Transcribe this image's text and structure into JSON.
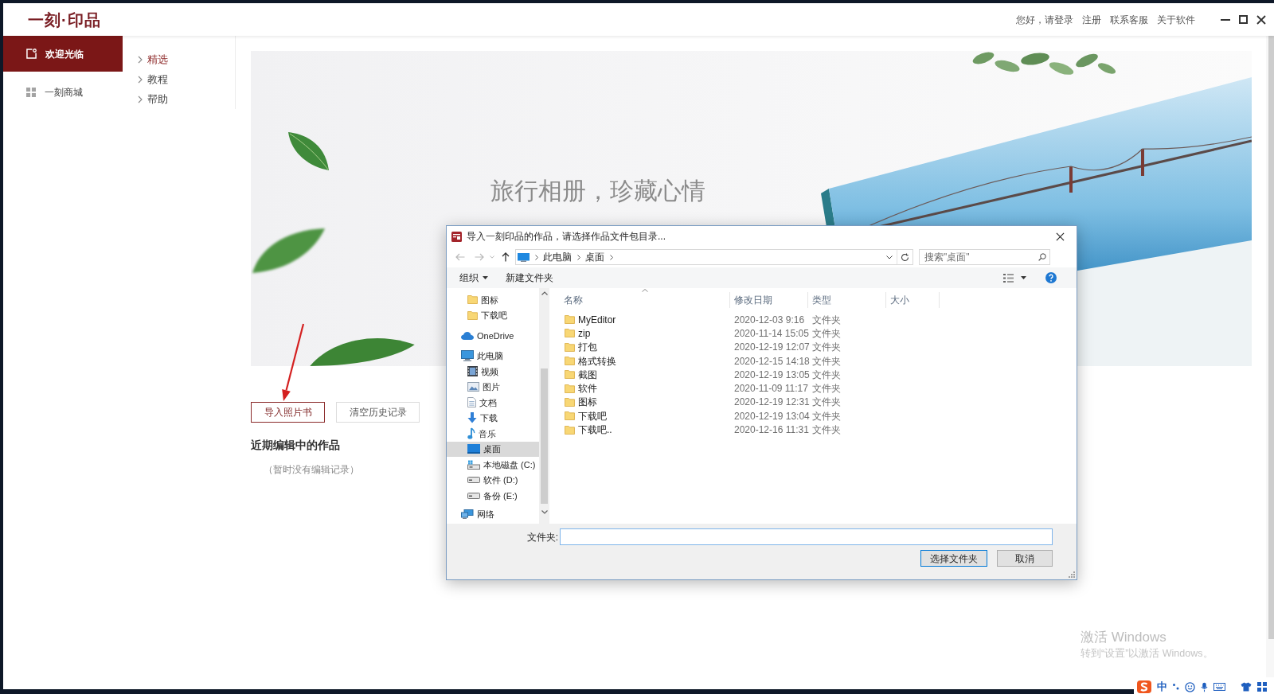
{
  "app": {
    "logo": "一刻·印品",
    "header_links": [
      "您好，请登录",
      "注册",
      "联系客服",
      "关于软件"
    ]
  },
  "sidebar": {
    "items": [
      {
        "label": "欢迎光临",
        "kind": "welcome",
        "selected": true
      },
      {
        "label": "一刻商城",
        "kind": "store",
        "selected": false
      }
    ]
  },
  "subnav": {
    "items": [
      {
        "label": "精选",
        "selected": true
      },
      {
        "label": "教程",
        "selected": false
      },
      {
        "label": "帮助",
        "selected": false
      }
    ]
  },
  "banner": {
    "headline": "旅行相册，珍藏心情"
  },
  "actions": [
    {
      "label": "导入照片书",
      "kind": "primary"
    },
    {
      "label": "清空历史记录",
      "kind": "secondary"
    }
  ],
  "recent": {
    "title": "近期编辑中的作品",
    "empty_text": "（暂时没有编辑记录）"
  },
  "dialog": {
    "title": "导入一刻印品的作品，请选择作品文件包目录...",
    "path": [
      "此电脑",
      "桌面"
    ],
    "search": {
      "placeholder": "搜索\"桌面\""
    },
    "toolbar": {
      "organize": "组织",
      "new_folder": "新建文件夹"
    },
    "nav_pane": {
      "items": [
        {
          "children": [
            {
              "label": "图标",
              "kind": "folder",
              "selected": false
            },
            {
              "label": "下载吧",
              "kind": "folder",
              "selected": false
            }
          ]
        },
        {
          "label": "OneDrive",
          "kind": "cloud",
          "selected": false
        },
        {
          "label": "此电脑",
          "kind": "computer",
          "selected": false,
          "children": [
            {
              "label": "视频",
              "kind": "video",
              "selected": false
            },
            {
              "label": "图片",
              "kind": "pictures",
              "selected": false
            },
            {
              "label": "文档",
              "kind": "documents",
              "selected": false
            },
            {
              "label": "下载",
              "kind": "downloads",
              "selected": false
            },
            {
              "label": "音乐",
              "kind": "music",
              "selected": false
            },
            {
              "label": "桌面",
              "kind": "desktop",
              "selected": true
            },
            {
              "label": "本地磁盘 (C:)",
              "kind": "system-drive",
              "selected": false
            },
            {
              "label": "软件 (D:)",
              "kind": "drive",
              "selected": false
            },
            {
              "label": "备份 (E:)",
              "kind": "drive",
              "selected": false
            }
          ]
        },
        {
          "label": "网络",
          "kind": "network",
          "selected": false
        }
      ]
    },
    "columns": [
      "名称",
      "修改日期",
      "类型",
      "大小"
    ],
    "rows": [
      {
        "name": "MyEditor",
        "modified": "2020-12-03 9:16",
        "type": "文件夹"
      },
      {
        "name": "zip",
        "modified": "2020-11-14 15:05",
        "type": "文件夹"
      },
      {
        "name": "打包",
        "modified": "2020-12-19 12:07",
        "type": "文件夹"
      },
      {
        "name": "格式转换",
        "modified": "2020-12-15 14:18",
        "type": "文件夹"
      },
      {
        "name": "截图",
        "modified": "2020-12-19 13:05",
        "type": "文件夹"
      },
      {
        "name": "软件",
        "modified": "2020-11-09 11:17",
        "type": "文件夹"
      },
      {
        "name": "图标",
        "modified": "2020-12-19 12:31",
        "type": "文件夹"
      },
      {
        "name": "下载吧",
        "modified": "2020-12-19 13:04",
        "type": "文件夹"
      },
      {
        "name": "下载吧..",
        "modified": "2020-12-16 11:31",
        "type": "文件夹"
      }
    ],
    "folder_field": {
      "label": "文件夹:"
    },
    "buttons": [
      {
        "label": "选择文件夹",
        "kind": "default"
      },
      {
        "label": "取消",
        "kind": "normal"
      }
    ]
  },
  "activation_notice": {
    "title": "激活 Windows",
    "subtitle": "转到“设置”以激活 Windows。"
  },
  "ime_toolbar": {
    "mode": "中"
  }
}
